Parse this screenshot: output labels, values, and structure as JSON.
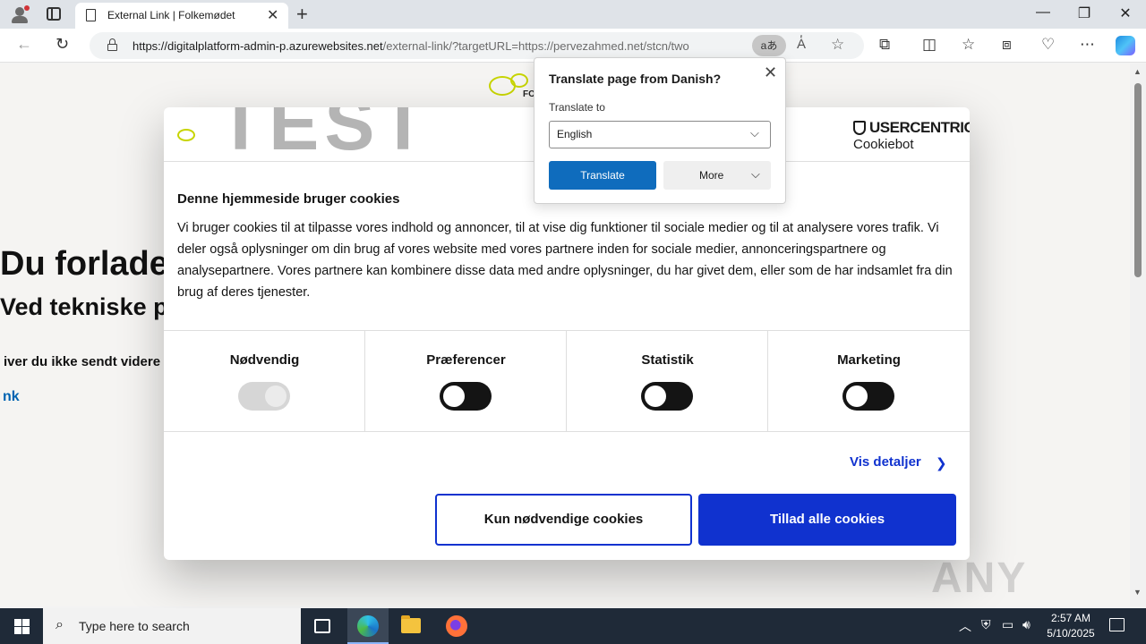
{
  "browser": {
    "tab_title": "External Link | Folkemødet",
    "url_host": "https://digitalplatform-admin-p.azurewebsites.net",
    "url_rest": "/external-link/?targetURL=https://pervezahmed.net/stcn/two",
    "translate_icon_text": "aあ",
    "read_aloud_text": "A̔",
    "window_controls": [
      "—",
      "❐",
      "✕"
    ]
  },
  "translate_popup": {
    "title": "Translate page from Danish?",
    "translate_to_label": "Translate to",
    "selected_language": "English",
    "translate_button": "Translate",
    "more_button": "More"
  },
  "page": {
    "logo_text": "FO",
    "heading": "Du forlader",
    "subheading": "Ved tekniske pr",
    "paragraph": "iver du ikke sendt videre",
    "link_text": "nk",
    "watermark": "ANY RUN"
  },
  "cookie_dialog": {
    "background_heading": "TEST",
    "brand_name": "USERCENTRICS",
    "brand_sub": "Cookiebot",
    "title": "Denne hjemmeside bruger cookies",
    "body": "Vi bruger cookies til at tilpasse vores indhold og annoncer, til at vise dig funktioner til sociale medier og til at analysere vores trafik. Vi deler også oplysninger om din brug af vores website med vores partnere inden for sociale medier, annonceringspartnere og analysepartnere. Vores partnere kan kombinere disse data med andre oplysninger, du har givet dem, eller som de har indsamlet fra din brug af deres tjenester.",
    "categories": [
      {
        "label": "Nødvendig",
        "enabled": true,
        "locked": true
      },
      {
        "label": "Præferencer",
        "enabled": false,
        "locked": false
      },
      {
        "label": "Statistik",
        "enabled": false,
        "locked": false
      },
      {
        "label": "Marketing",
        "enabled": false,
        "locked": false
      }
    ],
    "details_link": "Vis detaljer",
    "necessary_button": "Kun nødvendige cookies",
    "allow_all_button": "Tillad alle cookies",
    "colors": {
      "accent": "#1032cf",
      "toggle_off": "#141414"
    }
  },
  "taskbar": {
    "search_placeholder": "Type here to search",
    "time": "2:57 AM",
    "date": "5/10/2025"
  }
}
